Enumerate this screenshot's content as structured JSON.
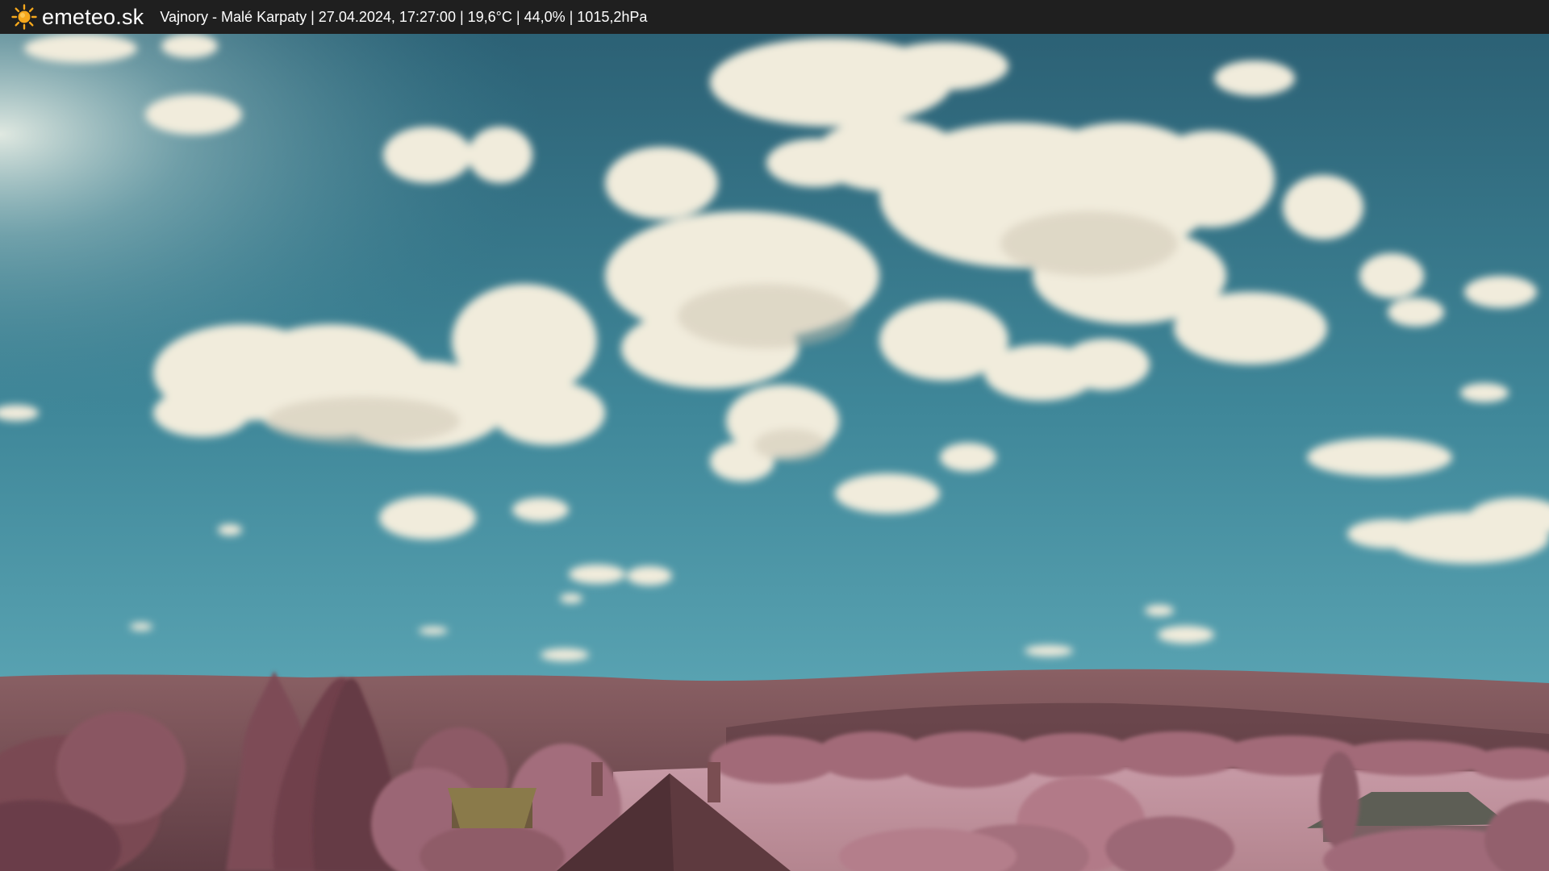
{
  "header": {
    "brand_icon": "sun-icon",
    "brand_name": "emeteo.sk",
    "location": "Vajnory - Malé Karpaty",
    "datetime": "27.04.2024, 17:27:00",
    "temperature": "19,6°C",
    "humidity": "44,0%",
    "pressure": "1015,2hPa",
    "separator": " | "
  },
  "colors": {
    "bar_background": "#1f1f1f",
    "sun": "#f6a81c",
    "sky_top": "#2f6579",
    "sky_horizon": "#63b0bd",
    "cloud": "#f1ecdc",
    "hills": "#7b5257",
    "foliage": "#a96f7d"
  }
}
